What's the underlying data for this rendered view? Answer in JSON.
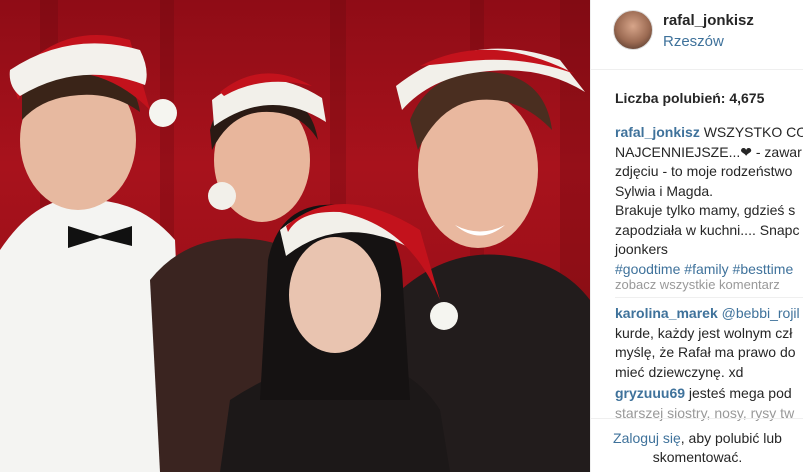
{
  "post": {
    "username": "rafal_jonkisz",
    "location": "Rzeszów",
    "likes_label": "Liczba polubień:",
    "likes_count": "4,675",
    "caption": {
      "user": "rafal_jonkisz",
      "line1_text": " WSZYSTKO CO",
      "line2": "NAJCENNIEJSZE...❤ - zawar",
      "line3": "zdjęciu - to moje rodzeństwo",
      "line4": "Sylwia i Magda.",
      "line5": "Brakuje tylko mamy, gdzieś s",
      "line6": "zapodziała w kuchni.... Snapc",
      "line7": "joonkers",
      "hashtags": [
        "#goodtime",
        "#family",
        "#besttime"
      ]
    },
    "more_comments": "zobacz wszystkie komentarz",
    "comments": [
      {
        "user": "karolina_marek",
        "lines": [
          " @bebbi_rojil",
          "kurde, każdy jest wolnym czł",
          "myślę, że Rafał ma prawo do",
          "mieć dziewczynę. xd"
        ]
      },
      {
        "user": "gryzuuu69",
        "lines": [
          " jesteś mega pod",
          "starszej siostry, nosy, rysy tw"
        ]
      }
    ],
    "footer": {
      "login_link": "Zaloguj się",
      "login_rest": ", aby polubić lub",
      "login_line2": "skomentować."
    }
  },
  "colors": {
    "link": "#3f729b",
    "text": "#262626",
    "muted": "#999999",
    "background_red": "#9a0f18"
  }
}
